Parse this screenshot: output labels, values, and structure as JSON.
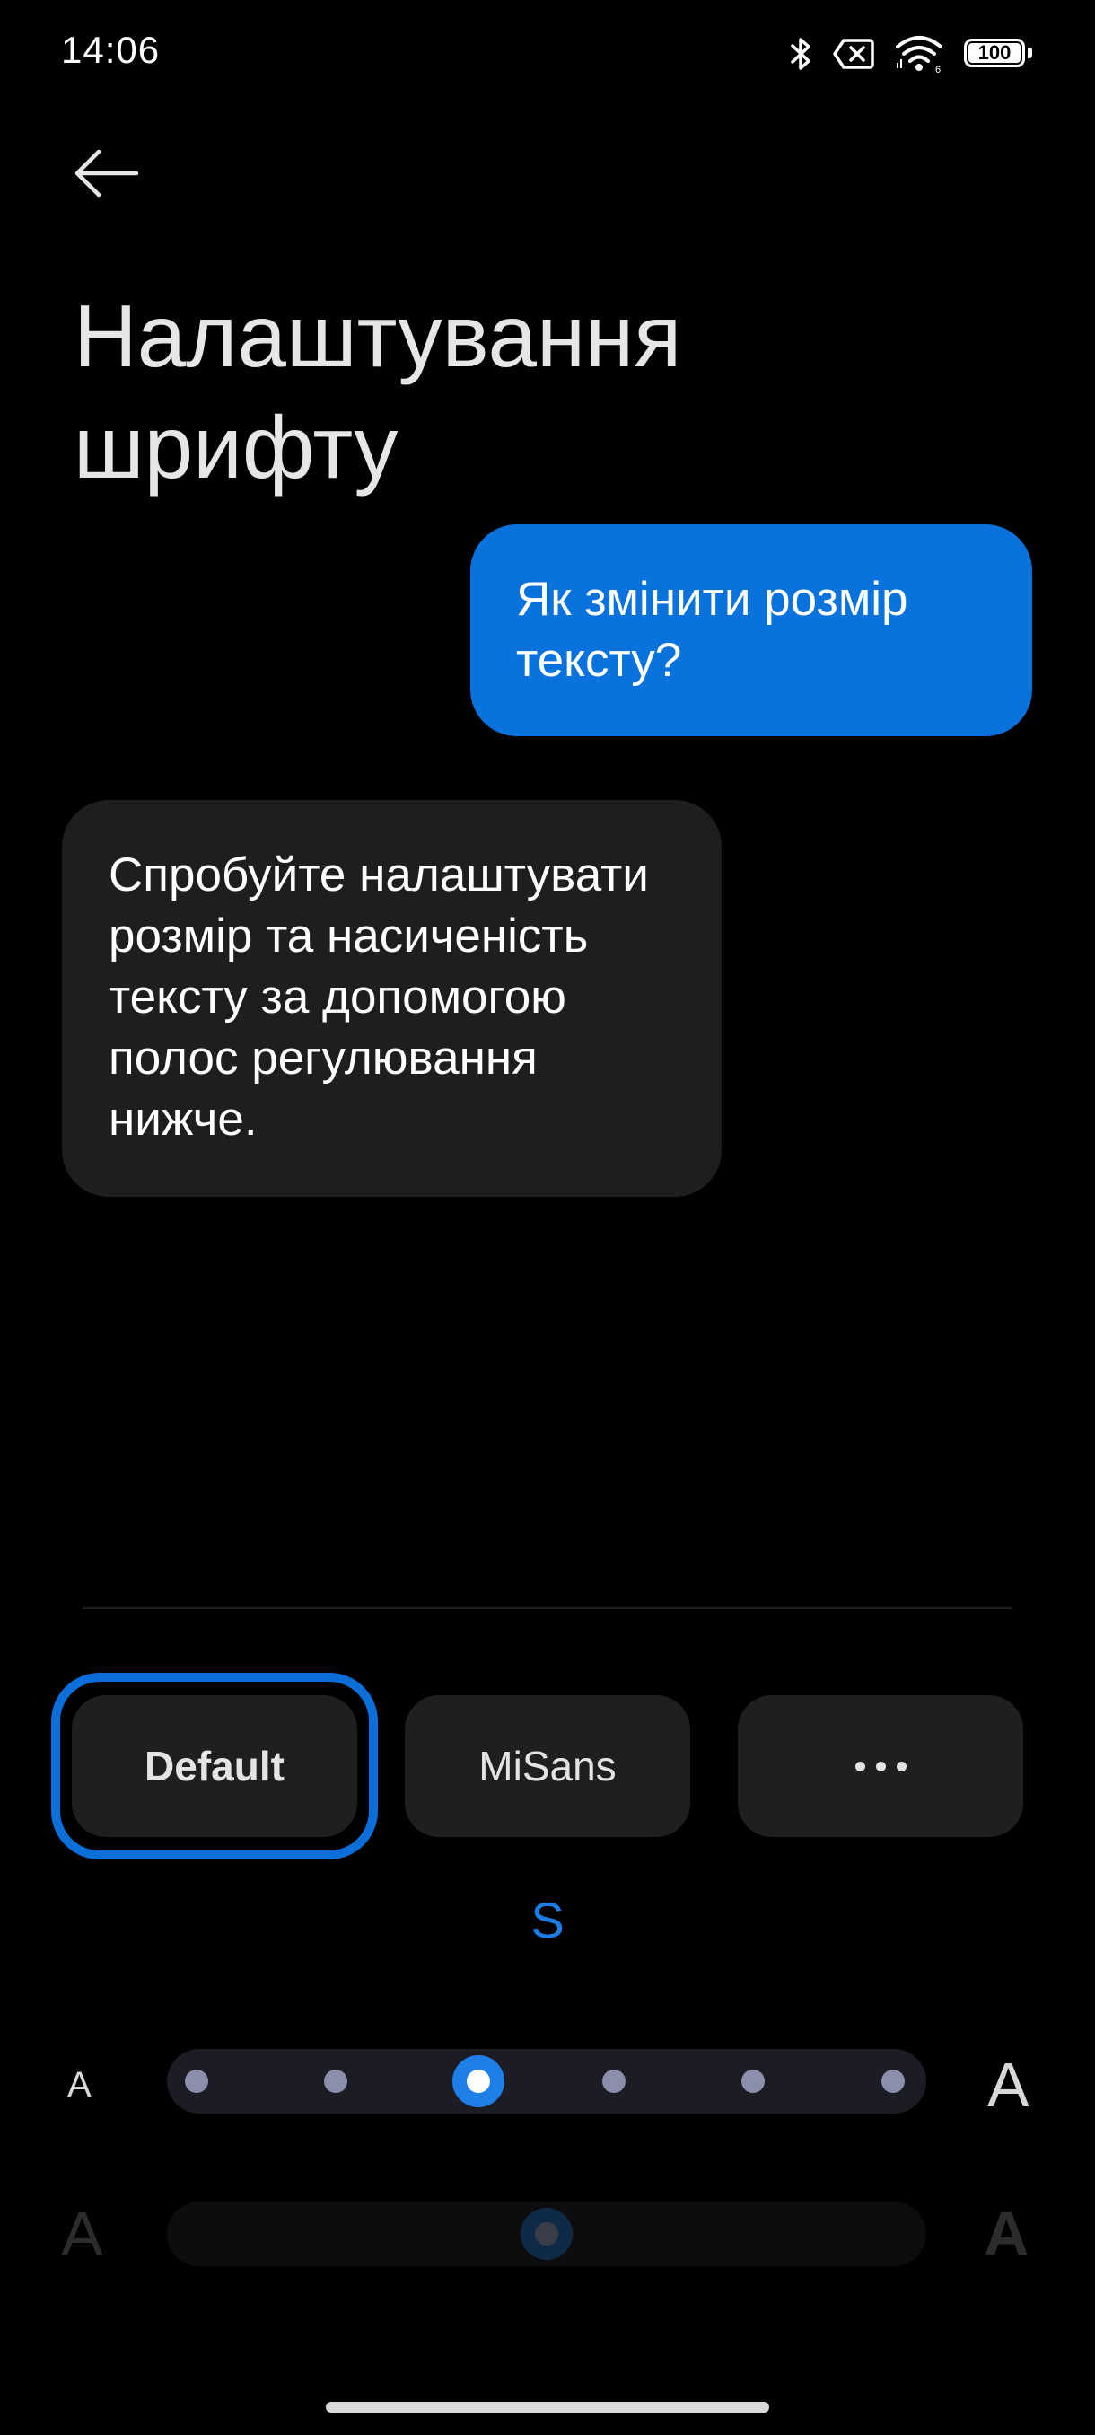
{
  "status_bar": {
    "time": "14:06",
    "icons": [
      "bluetooth-icon",
      "no-sim-icon",
      "wifi-icon"
    ],
    "battery_level": "100"
  },
  "header": {
    "back_icon": "arrow-left-icon",
    "title_line1": "Налаштування",
    "title_line2": "шрифту"
  },
  "preview": {
    "question": "Як змінити розмір тексту?",
    "answer": "Спробуйте налаштувати розмір та насиченість тексту за допомогою полос регулювання нижче."
  },
  "fonts": {
    "options": [
      "Default",
      "MiSans"
    ],
    "more_icon": "more-horizontal-icon",
    "selected": "Default"
  },
  "size_slider": {
    "current_label": "S",
    "min_label": "A",
    "max_label": "A",
    "steps": 6,
    "selected_index": 2
  },
  "weight_slider": {
    "min_label": "A",
    "max_label": "A",
    "value_fraction": 0.5,
    "enabled": false
  },
  "colors": {
    "accent": "#0a72dd",
    "background": "#000000",
    "bubble_dark": "#1e1e1e"
  }
}
